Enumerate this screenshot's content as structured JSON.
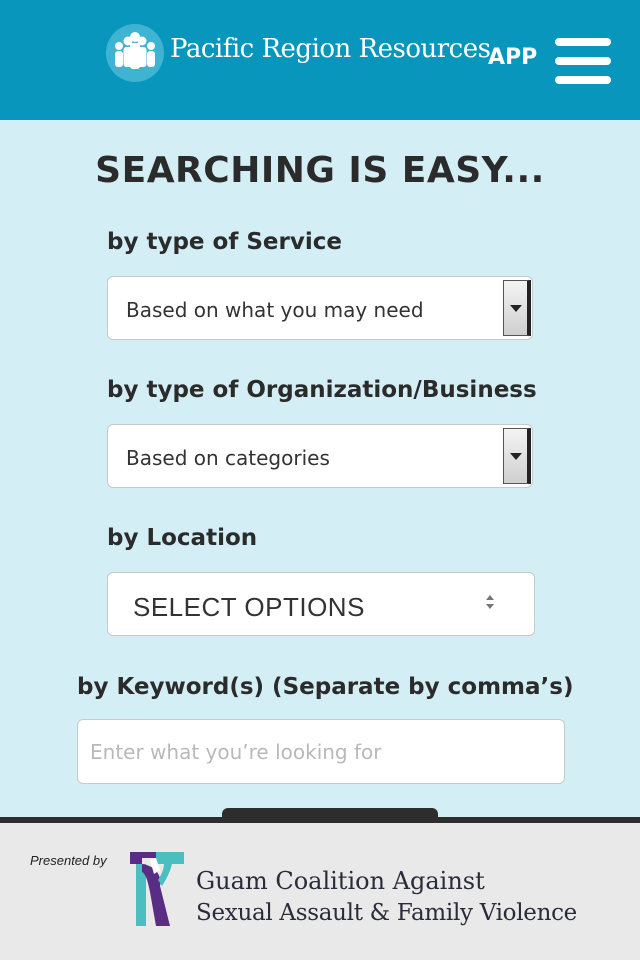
{
  "header": {
    "brand_text": "Pacific Region Resources",
    "app_label": "APP",
    "logo_icon": "people-group-icon",
    "menu_icon": "hamburger-menu-icon"
  },
  "main": {
    "heading": "SEARCHING IS EASY...",
    "service": {
      "label": "by type of Service",
      "value": "Based on what you may need"
    },
    "organization": {
      "label": "by type of Organization/Business",
      "value": "Based on categories"
    },
    "location": {
      "label": "by Location",
      "value": "SELECT OPTIONS"
    },
    "keyword": {
      "label": "by Keyword(s) (Separate by comma’s)",
      "placeholder": "Enter what you’re looking for",
      "value": ""
    }
  },
  "footer": {
    "presented_by": "Presented by",
    "org_line1": "Guam Coalition Against",
    "org_line2": "Sexual Assault & Family Violence",
    "logo_icon": "gcasafv-logo-icon"
  },
  "colors": {
    "header_bg": "#0896bd",
    "page_bg": "#d4eef5",
    "footer_bg": "#e9e9e9",
    "logo_purple": "#5b2c83",
    "logo_teal": "#4bbfbf"
  }
}
